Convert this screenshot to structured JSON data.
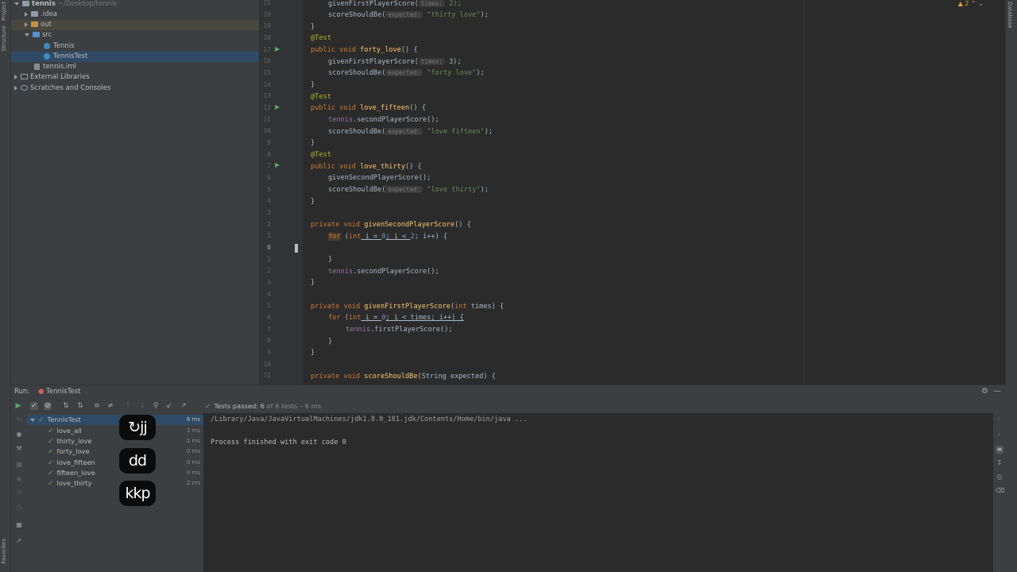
{
  "project": {
    "root_name": "tennis",
    "root_path": "~/Desktop/tennis",
    "items": [
      {
        "label": ".idea",
        "kind": "folder"
      },
      {
        "label": "out",
        "kind": "folder-orange"
      },
      {
        "label": "src",
        "kind": "folder-blue"
      },
      {
        "label": "Tennis",
        "kind": "class"
      },
      {
        "label": "TennisTest",
        "kind": "class"
      },
      {
        "label": "tennis.iml",
        "kind": "file"
      },
      {
        "label": "External Libraries",
        "kind": "lib"
      },
      {
        "label": "Scratches and Consoles",
        "kind": "scratch"
      }
    ]
  },
  "left_strip": {
    "project": "Project",
    "structure": "Structure",
    "favorites": "Favorites"
  },
  "right_strip": {
    "database": "Database"
  },
  "editor": {
    "warnings_count": "2",
    "line_numbers": [
      "21",
      "20",
      "19",
      "18",
      "17",
      "16",
      "15",
      "14",
      "13",
      "12",
      "11",
      "10",
      "9",
      "8",
      "7",
      "6",
      "5",
      "4",
      "3",
      "2",
      "1",
      "0",
      "1",
      "2",
      "3",
      "4",
      "5",
      "6",
      "7",
      "8",
      "9",
      "10",
      "11"
    ],
    "code": {
      "l0_call": "givenFirstPlayerScore(",
      "l0_hint": "times:",
      "l0_arg": " 2);",
      "l1_call": "scoreShouldBe(",
      "l1_hint": "expected:",
      "l1_str": "\"thirty love\"",
      "l1_end": ");",
      "l2": "}",
      "l3": "@Test",
      "l4_kw": "public void ",
      "l4_fn": "forty_love",
      "l4_end": "() {",
      "l5_call": "givenFirstPlayerScore(",
      "l5_hint": "times:",
      "l5_arg": " 3);",
      "l6_call": "scoreShouldBe(",
      "l6_hint": "expected:",
      "l6_str": "\"forty love\"",
      "l6_end": ");",
      "l7": "}",
      "l8": "@Test",
      "l9_kw": "public void ",
      "l9_fn": "love_fifteen",
      "l9_end": "() {",
      "l10_fld": "tennis",
      "l10_rest": ".secondPlayerScore();",
      "l11_call": "scoreShouldBe(",
      "l11_hint": "expected:",
      "l11_str": "\"love fifteen\"",
      "l11_end": ");",
      "l12": "}",
      "l13": "@Test",
      "l14_kw": "public void ",
      "l14_fn": "love_thirty",
      "l14_end": "() {",
      "l15": "givenSecondPlayerScore();",
      "l16_call": "scoreShouldBe(",
      "l16_hint": "expected:",
      "l16_str": "\"love thirty\"",
      "l16_end": ");",
      "l17": "}",
      "l19_kw": "private void ",
      "l19_fn": "givenSecondPlayerScore",
      "l19_end": "() {",
      "l20_for": "for",
      "l20_a": " (",
      "l20_int": "int",
      "l20_b": " i = ",
      "l20_n0": "0",
      "l20_c": "; i < ",
      "l20_n2": "2",
      "l20_d": "; i++) {",
      "l22": "}",
      "l23_fld": "tennis",
      "l23_rest": ".secondPlayerScore();",
      "l24": "}",
      "l26_kw": "private void ",
      "l26_fn": "givenFirstPlayerScore",
      "l26_a": "(",
      "l26_int": "int",
      "l26_end": " times) {",
      "l27_for": "for",
      "l27_a": " (",
      "l27_int": "int",
      "l27_b": " i = ",
      "l27_n0": "0",
      "l27_c": "; i < times; i++) {",
      "l28_fld": "tennis",
      "l28_rest": ".firstPlayerScore();",
      "l29": "}",
      "l30": "}",
      "l32_kw": "private void ",
      "l32_fn": "scoreShouldBe",
      "l32_end": "(String expected) {"
    }
  },
  "run": {
    "label": "Run:",
    "tab": "TennisTest",
    "status": "Tests passed: 6",
    "status_detail": "of 6 tests – 6 ms",
    "tests": [
      {
        "name": "TennisTest",
        "time": "6 ms",
        "root": true
      },
      {
        "name": "love_all",
        "time": "3 ms"
      },
      {
        "name": "thirty_love",
        "time": "1 ms"
      },
      {
        "name": "forty_love",
        "time": "0 ms"
      },
      {
        "name": "love_fifteen",
        "time": "0 ms"
      },
      {
        "name": "fifteen_love",
        "time": "0 ms"
      },
      {
        "name": "love_thirty",
        "time": "2 ms"
      }
    ],
    "console": {
      "cmd": "/Library/Java/JavaVirtualMachines/jdk1.8.0_181.jdk/Contents/Home/bin/java ...",
      "exit": "Process finished with exit code 0"
    }
  },
  "key_overlays": [
    "↻jj",
    "dd",
    "kkp"
  ]
}
